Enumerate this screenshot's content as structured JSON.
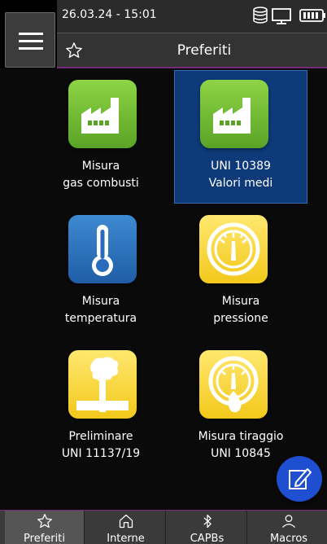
{
  "status": {
    "datetime": "26.03.24 - 15:01"
  },
  "header": {
    "title": "Preferiti"
  },
  "tiles": [
    {
      "line1": "Misura",
      "line2": "gas combusti",
      "icon": "factory-icon",
      "color": "#6bb832"
    },
    {
      "line1": "UNI 10389",
      "line2": "Valori medi",
      "icon": "factory-icon",
      "color": "#6bb832",
      "selected": true
    },
    {
      "line1": "Misura",
      "line2": "temperatura",
      "icon": "thermometer-icon",
      "color": "#2f72c0"
    },
    {
      "line1": "Misura",
      "line2": "pressione",
      "icon": "gauge-icon",
      "color": "#f4cc22"
    },
    {
      "line1": "Preliminare",
      "line2": "UNI 11137/19",
      "icon": "pipe-smoke-icon",
      "color": "#f4cc22"
    },
    {
      "line1": "Misura tiraggio",
      "line2": "UNI 10845",
      "icon": "draft-gauge-icon",
      "color": "#f4cc22"
    }
  ],
  "nav": [
    {
      "label": "Preferiti",
      "icon": "star-icon",
      "active": true
    },
    {
      "label": "Interne",
      "icon": "home-icon"
    },
    {
      "label": "CAPBs",
      "icon": "bluetooth-icon"
    },
    {
      "label": "Macros",
      "icon": "user-icon"
    }
  ],
  "colors": {
    "accent": "#7a2a7a",
    "selected_tile": "#0e3a7a",
    "fab": "#1e4fd0"
  }
}
